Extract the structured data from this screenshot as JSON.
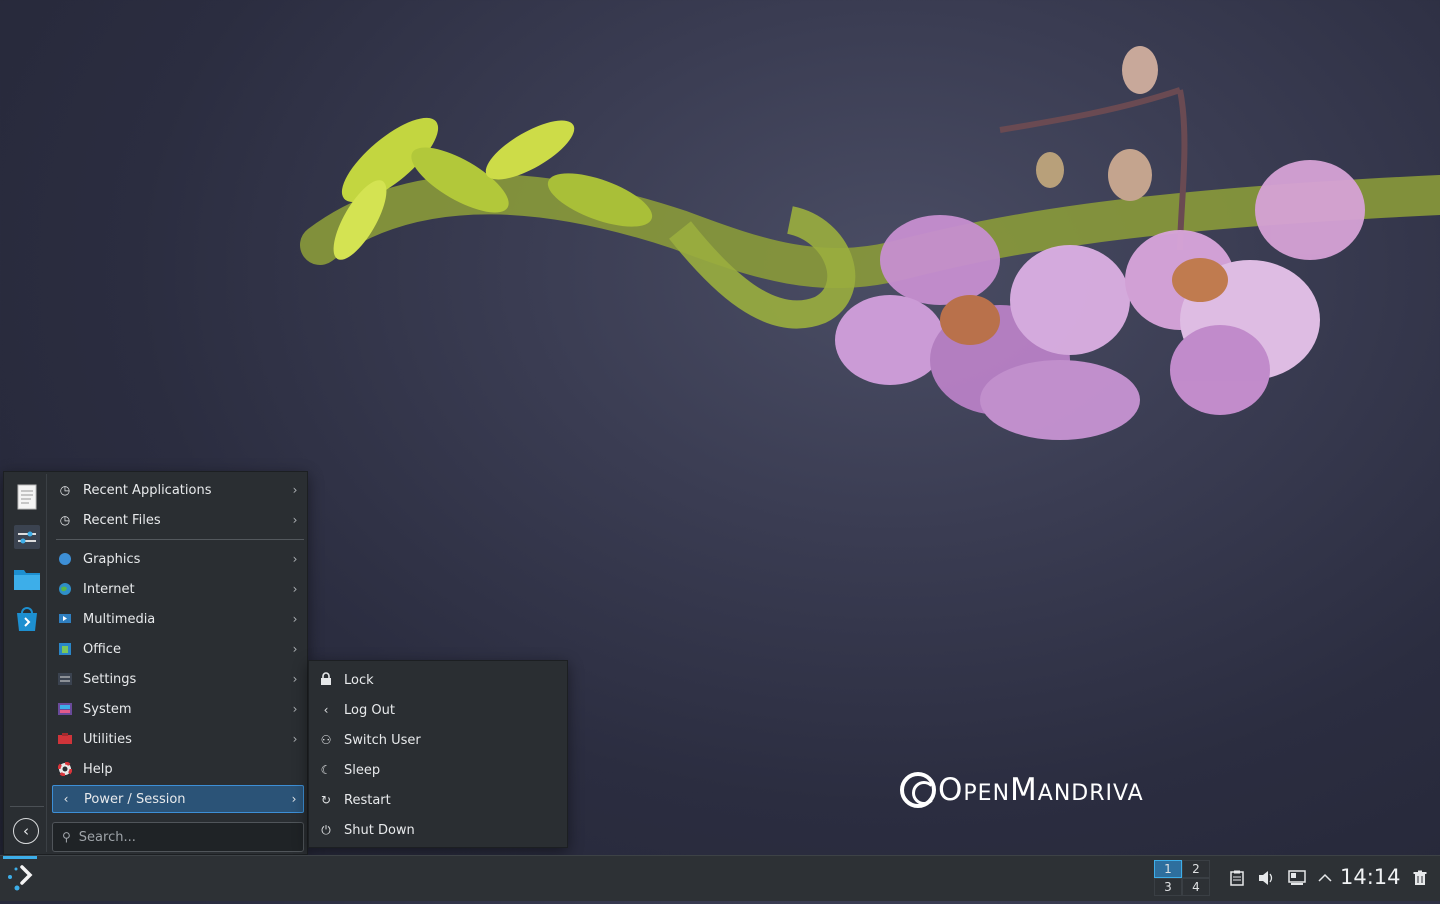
{
  "wallpaper": {
    "brand": "OpenMandriva"
  },
  "launcher": {
    "favorites": [
      "text-editor-icon",
      "system-settings-icon",
      "file-manager-icon",
      "software-center-icon"
    ],
    "menu": [
      {
        "label": "Recent Applications",
        "icon": "clock-icon"
      },
      {
        "label": "Recent Files",
        "icon": "clock-icon"
      },
      {
        "label": "Graphics",
        "icon": "graphics-icon"
      },
      {
        "label": "Internet",
        "icon": "globe-icon"
      },
      {
        "label": "Multimedia",
        "icon": "multimedia-icon"
      },
      {
        "label": "Office",
        "icon": "office-icon"
      },
      {
        "label": "Settings",
        "icon": "settings-icon"
      },
      {
        "label": "System",
        "icon": "system-icon"
      },
      {
        "label": "Utilities",
        "icon": "utilities-icon"
      },
      {
        "label": "Help",
        "icon": "help-icon"
      },
      {
        "label": "Power / Session",
        "icon": "back-chevron-icon",
        "active": true
      }
    ],
    "search": {
      "placeholder": "Search..."
    }
  },
  "power_submenu": {
    "items": [
      {
        "label": "Lock",
        "icon": "lock-icon"
      },
      {
        "label": "Log Out",
        "icon": "logout-icon"
      },
      {
        "label": "Switch User",
        "icon": "switch-user-icon"
      },
      {
        "label": "Sleep",
        "icon": "sleep-icon"
      },
      {
        "label": "Restart",
        "icon": "restart-icon"
      },
      {
        "label": "Shut Down",
        "icon": "power-icon"
      }
    ]
  },
  "taskbar": {
    "pager": {
      "desktops": [
        "1",
        "2",
        "3",
        "4"
      ],
      "current": "1"
    },
    "tray": [
      "clipboard-icon",
      "volume-icon",
      "network-icon",
      "expand-tray-icon"
    ],
    "clock": "14:14",
    "trash_icon": "trash-icon"
  },
  "colors": {
    "accent": "#3daee9",
    "active_item_bg": "#2b5377",
    "panel_bg": "#2a2e32"
  }
}
